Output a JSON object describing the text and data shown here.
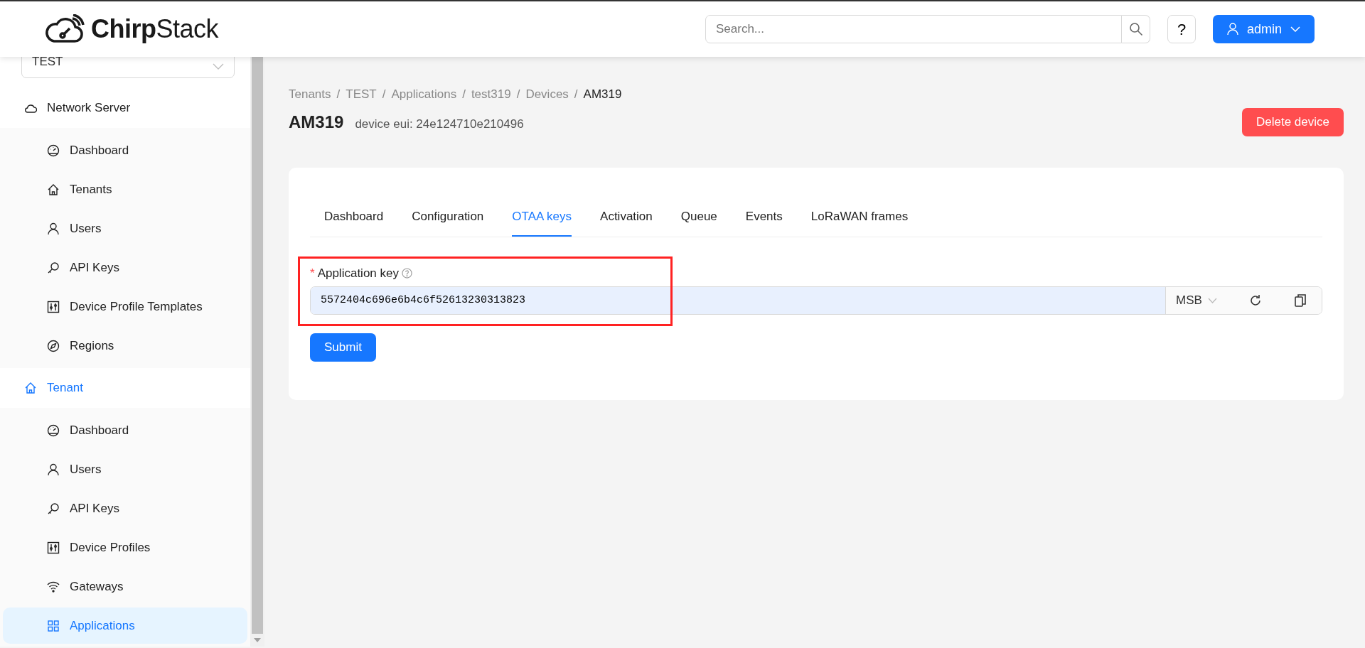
{
  "header": {
    "logo": "**Chirp**Stack",
    "search": {
      "placeholder": "Search..."
    },
    "help": "?",
    "user": "admin"
  },
  "sidebar": {
    "tenant_select": "TEST",
    "sections": [
      {
        "label": "Network Server",
        "kind": "cloud",
        "selected": false,
        "items": [
          {
            "label": "Dashboard",
            "kind": "dashboard",
            "selected": false
          },
          {
            "label": "Tenants",
            "kind": "home",
            "selected": false
          },
          {
            "label": "Users",
            "kind": "user",
            "selected": false
          },
          {
            "label": "API Keys",
            "kind": "key",
            "selected": false
          },
          {
            "label": "Device Profile Templates",
            "kind": "sliders",
            "selected": false
          },
          {
            "label": "Regions",
            "kind": "compass",
            "selected": false
          }
        ]
      },
      {
        "label": "Tenant",
        "kind": "home",
        "selected": true,
        "items": [
          {
            "label": "Dashboard",
            "kind": "dashboard",
            "selected": false
          },
          {
            "label": "Users",
            "kind": "user",
            "selected": false
          },
          {
            "label": "API Keys",
            "kind": "key",
            "selected": false
          },
          {
            "label": "Device Profiles",
            "kind": "sliders",
            "selected": false
          },
          {
            "label": "Gateways",
            "kind": "wifi",
            "selected": false
          },
          {
            "label": "Applications",
            "kind": "grid",
            "selected": true
          }
        ]
      }
    ]
  },
  "breadcrumb": [
    {
      "label": "Tenants",
      "separator": "/"
    },
    {
      "label": "TEST",
      "separator": "/"
    },
    {
      "label": "Applications",
      "separator": "/"
    },
    {
      "label": "test319",
      "separator": "/"
    },
    {
      "label": "Devices",
      "separator": "/"
    },
    {
      "label": "AM319"
    }
  ],
  "page": {
    "title": "AM319",
    "subtitle": "device eui: 24e124710e210496",
    "delete_button": "Delete device"
  },
  "tabs": [
    {
      "label": "Dashboard",
      "selected": false
    },
    {
      "label": "Configuration",
      "selected": false
    },
    {
      "label": "OTAA keys",
      "selected": true
    },
    {
      "label": "Activation",
      "selected": false
    },
    {
      "label": "Queue",
      "selected": false
    },
    {
      "label": "Events",
      "selected": false
    },
    {
      "label": "LoRaWAN frames",
      "selected": false
    }
  ],
  "form": {
    "required_mark": "*",
    "label": "Application key",
    "value": "5572404c696e6b4c6f52613230313823",
    "byte_order": "MSB",
    "submit": "Submit"
  }
}
